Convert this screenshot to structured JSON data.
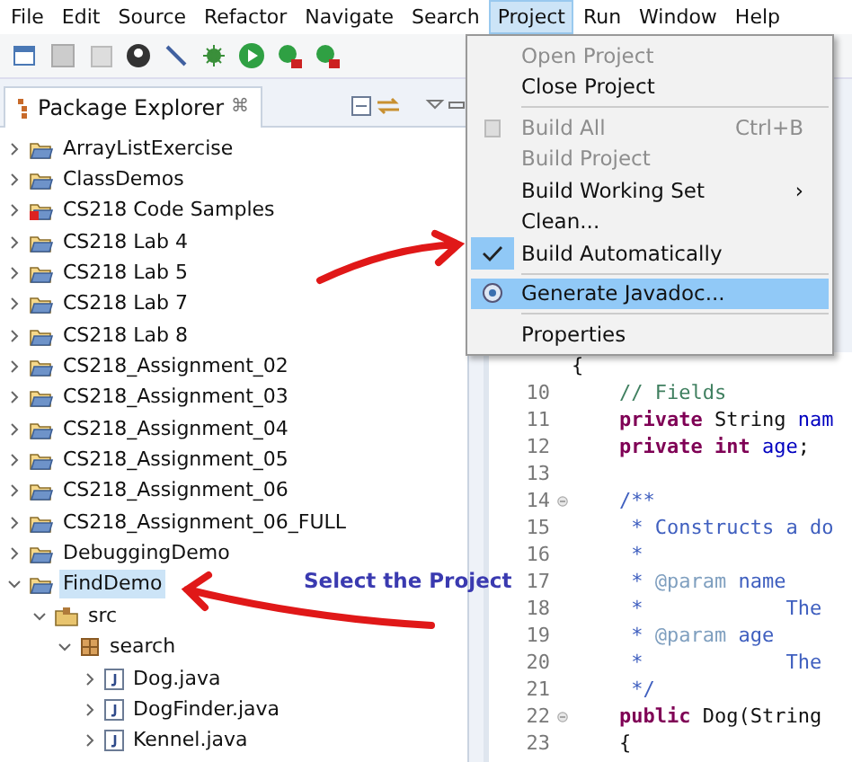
{
  "menu_bar": [
    {
      "label": "File",
      "selected": false
    },
    {
      "label": "Edit",
      "selected": false
    },
    {
      "label": "Source",
      "selected": false
    },
    {
      "label": "Refactor",
      "selected": false
    },
    {
      "label": "Navigate",
      "selected": false
    },
    {
      "label": "Search",
      "selected": false
    },
    {
      "label": "Project",
      "selected": true
    },
    {
      "label": "Run",
      "selected": false
    },
    {
      "label": "Window",
      "selected": false
    },
    {
      "label": "Help",
      "selected": false
    }
  ],
  "package_explorer": {
    "title": "Package Explorer",
    "close": "⌘",
    "tree": [
      {
        "label": "ArrayListExercise",
        "expanded": false,
        "kind": "project",
        "selected": false
      },
      {
        "label": "ClassDemos",
        "expanded": false,
        "kind": "project",
        "selected": false
      },
      {
        "label": "CS218 Code Samples",
        "expanded": false,
        "kind": "project-error",
        "selected": false
      },
      {
        "label": "CS218 Lab 4",
        "expanded": false,
        "kind": "project",
        "selected": false
      },
      {
        "label": "CS218 Lab 5",
        "expanded": false,
        "kind": "project",
        "selected": false
      },
      {
        "label": "CS218 Lab 7",
        "expanded": false,
        "kind": "project",
        "selected": false
      },
      {
        "label": "CS218 Lab 8",
        "expanded": false,
        "kind": "project",
        "selected": false
      },
      {
        "label": "CS218_Assignment_02",
        "expanded": false,
        "kind": "project",
        "selected": false
      },
      {
        "label": "CS218_Assignment_03",
        "expanded": false,
        "kind": "project",
        "selected": false
      },
      {
        "label": "CS218_Assignment_04",
        "expanded": false,
        "kind": "project",
        "selected": false
      },
      {
        "label": "CS218_Assignment_05",
        "expanded": false,
        "kind": "project",
        "selected": false
      },
      {
        "label": "CS218_Assignment_06",
        "expanded": false,
        "kind": "project",
        "selected": false
      },
      {
        "label": "CS218_Assignment_06_FULL",
        "expanded": false,
        "kind": "project",
        "selected": false
      },
      {
        "label": "DebuggingDemo",
        "expanded": false,
        "kind": "project",
        "selected": false
      },
      {
        "label": "FindDemo",
        "expanded": true,
        "kind": "project",
        "selected": true,
        "children": [
          {
            "label": "src",
            "expanded": true,
            "kind": "source-folder",
            "selected": false,
            "children": [
              {
                "label": "search",
                "expanded": true,
                "kind": "package",
                "selected": false,
                "children": [
                  {
                    "label": "Dog.java",
                    "expanded": false,
                    "kind": "java-file",
                    "selected": false
                  },
                  {
                    "label": "DogFinder.java",
                    "expanded": false,
                    "kind": "java-file",
                    "selected": false
                  },
                  {
                    "label": "Kennel.java",
                    "expanded": false,
                    "kind": "java-file",
                    "selected": false
                  }
                ]
              }
            ]
          }
        ]
      }
    ]
  },
  "project_menu": [
    {
      "kind": "item",
      "label": "Open Project",
      "disabled": true,
      "selected": false
    },
    {
      "kind": "item",
      "label": "Close Project",
      "disabled": false,
      "selected": false
    },
    {
      "kind": "separator"
    },
    {
      "kind": "item",
      "label": "Build All",
      "shortcut": "Ctrl+B",
      "disabled": true,
      "selected": false,
      "icon": true
    },
    {
      "kind": "item",
      "label": "Build Project",
      "disabled": true,
      "selected": false
    },
    {
      "kind": "submenu",
      "label": "Build Working Set",
      "submenu_arrow": "›",
      "disabled": false,
      "selected": false
    },
    {
      "kind": "item",
      "label": "Clean...",
      "disabled": false,
      "selected": false
    },
    {
      "kind": "check",
      "label": "Build Automatically",
      "checked": true,
      "disabled": false,
      "selected": false
    },
    {
      "kind": "separator"
    },
    {
      "kind": "item",
      "label": "Generate Javadoc...",
      "disabled": false,
      "selected": true,
      "icon": true
    },
    {
      "kind": "separator"
    },
    {
      "kind": "item",
      "label": "Properties",
      "disabled": false,
      "selected": false
    }
  ],
  "editor": {
    "lines": [
      {
        "segments": [
          {
            "kind": "plain",
            "text": "{"
          }
        ]
      },
      {
        "number": "10",
        "segments": [
          {
            "kind": "comment",
            "text": "    // Fields"
          }
        ]
      },
      {
        "number": "11",
        "segments": [
          {
            "kind": "keyword",
            "text": "    private"
          },
          {
            "kind": "plain",
            "text": " String "
          },
          {
            "kind": "field",
            "text": "nam"
          }
        ]
      },
      {
        "number": "12",
        "segments": [
          {
            "kind": "keyword",
            "text": "    private int"
          },
          {
            "kind": "field",
            "text": " age"
          },
          {
            "kind": "plain",
            "text": ";"
          }
        ]
      },
      {
        "number": "13"
      },
      {
        "number": "14",
        "fold": true,
        "segments": [
          {
            "kind": "javadoc",
            "text": "    /**"
          }
        ]
      },
      {
        "number": "15",
        "segments": [
          {
            "kind": "javadoc",
            "text": "     * Constructs a do"
          }
        ]
      },
      {
        "number": "16",
        "segments": [
          {
            "kind": "javadoc",
            "text": "     *"
          }
        ]
      },
      {
        "number": "17",
        "segments": [
          {
            "kind": "javadoc",
            "text": "     * "
          },
          {
            "kind": "tag",
            "text": "@param"
          },
          {
            "kind": "javadoc",
            "text": " name"
          }
        ]
      },
      {
        "number": "18",
        "segments": [
          {
            "kind": "javadoc",
            "text": "     *            The"
          }
        ]
      },
      {
        "number": "19",
        "segments": [
          {
            "kind": "javadoc",
            "text": "     * "
          },
          {
            "kind": "tag",
            "text": "@param"
          },
          {
            "kind": "javadoc",
            "text": " age"
          }
        ]
      },
      {
        "number": "20",
        "segments": [
          {
            "kind": "javadoc",
            "text": "     *            The"
          }
        ]
      },
      {
        "number": "21",
        "segments": [
          {
            "kind": "javadoc",
            "text": "     */"
          }
        ]
      },
      {
        "number": "22",
        "fold": true,
        "segments": [
          {
            "kind": "keyword",
            "text": "    public"
          },
          {
            "kind": "plain",
            "text": " Dog(String"
          }
        ]
      },
      {
        "number": "23",
        "segments": [
          {
            "kind": "plain",
            "text": "    {"
          }
        ]
      }
    ]
  },
  "annotation": {
    "text": "Select the Project"
  }
}
